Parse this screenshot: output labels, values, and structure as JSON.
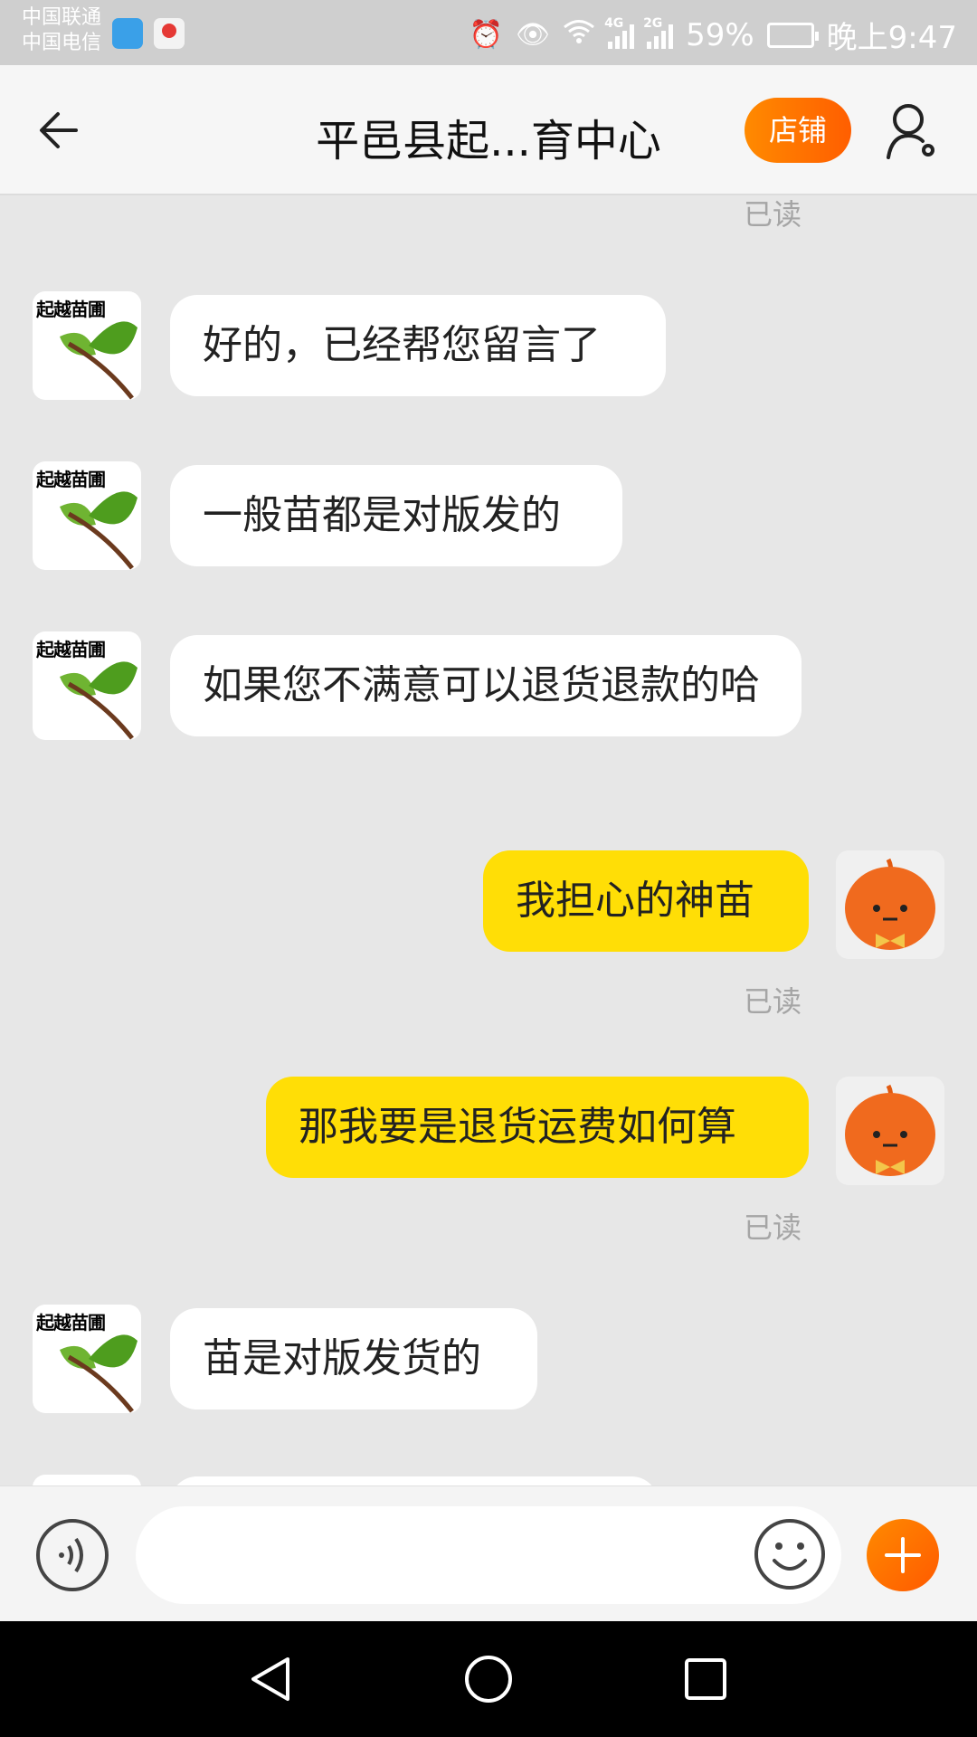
{
  "status_bar": {
    "carrier1": "中国联通",
    "carrier2": "中国电信",
    "network1": "4G",
    "network2": "2G",
    "battery": "59%",
    "time": "晚上9:47"
  },
  "header": {
    "title": "平邑县起...育中心",
    "shop_button": "店铺"
  },
  "shop_avatar_text": "起越苗圃",
  "messages": [
    {
      "side": "read-only",
      "read": "已读"
    },
    {
      "side": "in",
      "text": "好的，已经帮您留言了"
    },
    {
      "side": "in",
      "text": "一般苗都是对版发的"
    },
    {
      "side": "in",
      "text": "如果您不满意可以退货退款的哈"
    },
    {
      "side": "out",
      "text": "我担心的神苗",
      "read": "已读"
    },
    {
      "side": "out",
      "text": "那我要是退货运费如何算",
      "read": "已读"
    },
    {
      "side": "in",
      "text": "苗是对版发货的"
    }
  ],
  "input": {
    "value": "",
    "placeholder": ""
  },
  "colors": {
    "accent_orange": "#ff6a00",
    "outgoing_bubble": "#ffde06",
    "incoming_bubble": "#ffffff",
    "chat_bg": "#e7e7e7"
  },
  "icons": [
    "back-arrow-icon",
    "user-settings-icon",
    "voice-icon",
    "emoji-icon",
    "plus-icon",
    "alarm-icon",
    "eye-icon",
    "wifi-icon",
    "signal-icon",
    "battery-icon"
  ]
}
